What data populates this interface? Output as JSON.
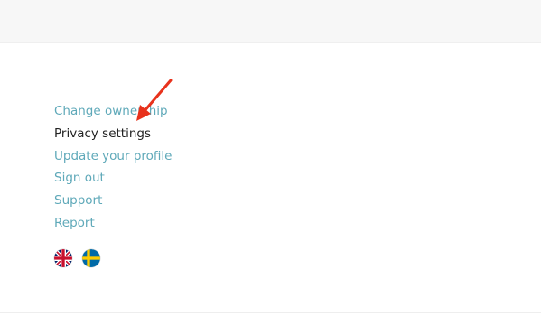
{
  "menu": {
    "items": [
      {
        "label": "Change ownership",
        "current": false
      },
      {
        "label": "Privacy settings",
        "current": true
      },
      {
        "label": "Update your profile",
        "current": false
      },
      {
        "label": "Sign out",
        "current": false
      },
      {
        "label": "Support",
        "current": false
      },
      {
        "label": "Report",
        "current": false
      }
    ]
  },
  "languages": [
    {
      "icon": "uk-flag-icon",
      "label": "English"
    },
    {
      "icon": "sweden-flag-icon",
      "label": "Svenska"
    }
  ],
  "annotation": {
    "icon": "red-arrow-icon",
    "color": "#e8321c"
  },
  "colors": {
    "link": "#5fa9b9",
    "current": "#222222",
    "top_band": "#f7f7f7"
  }
}
